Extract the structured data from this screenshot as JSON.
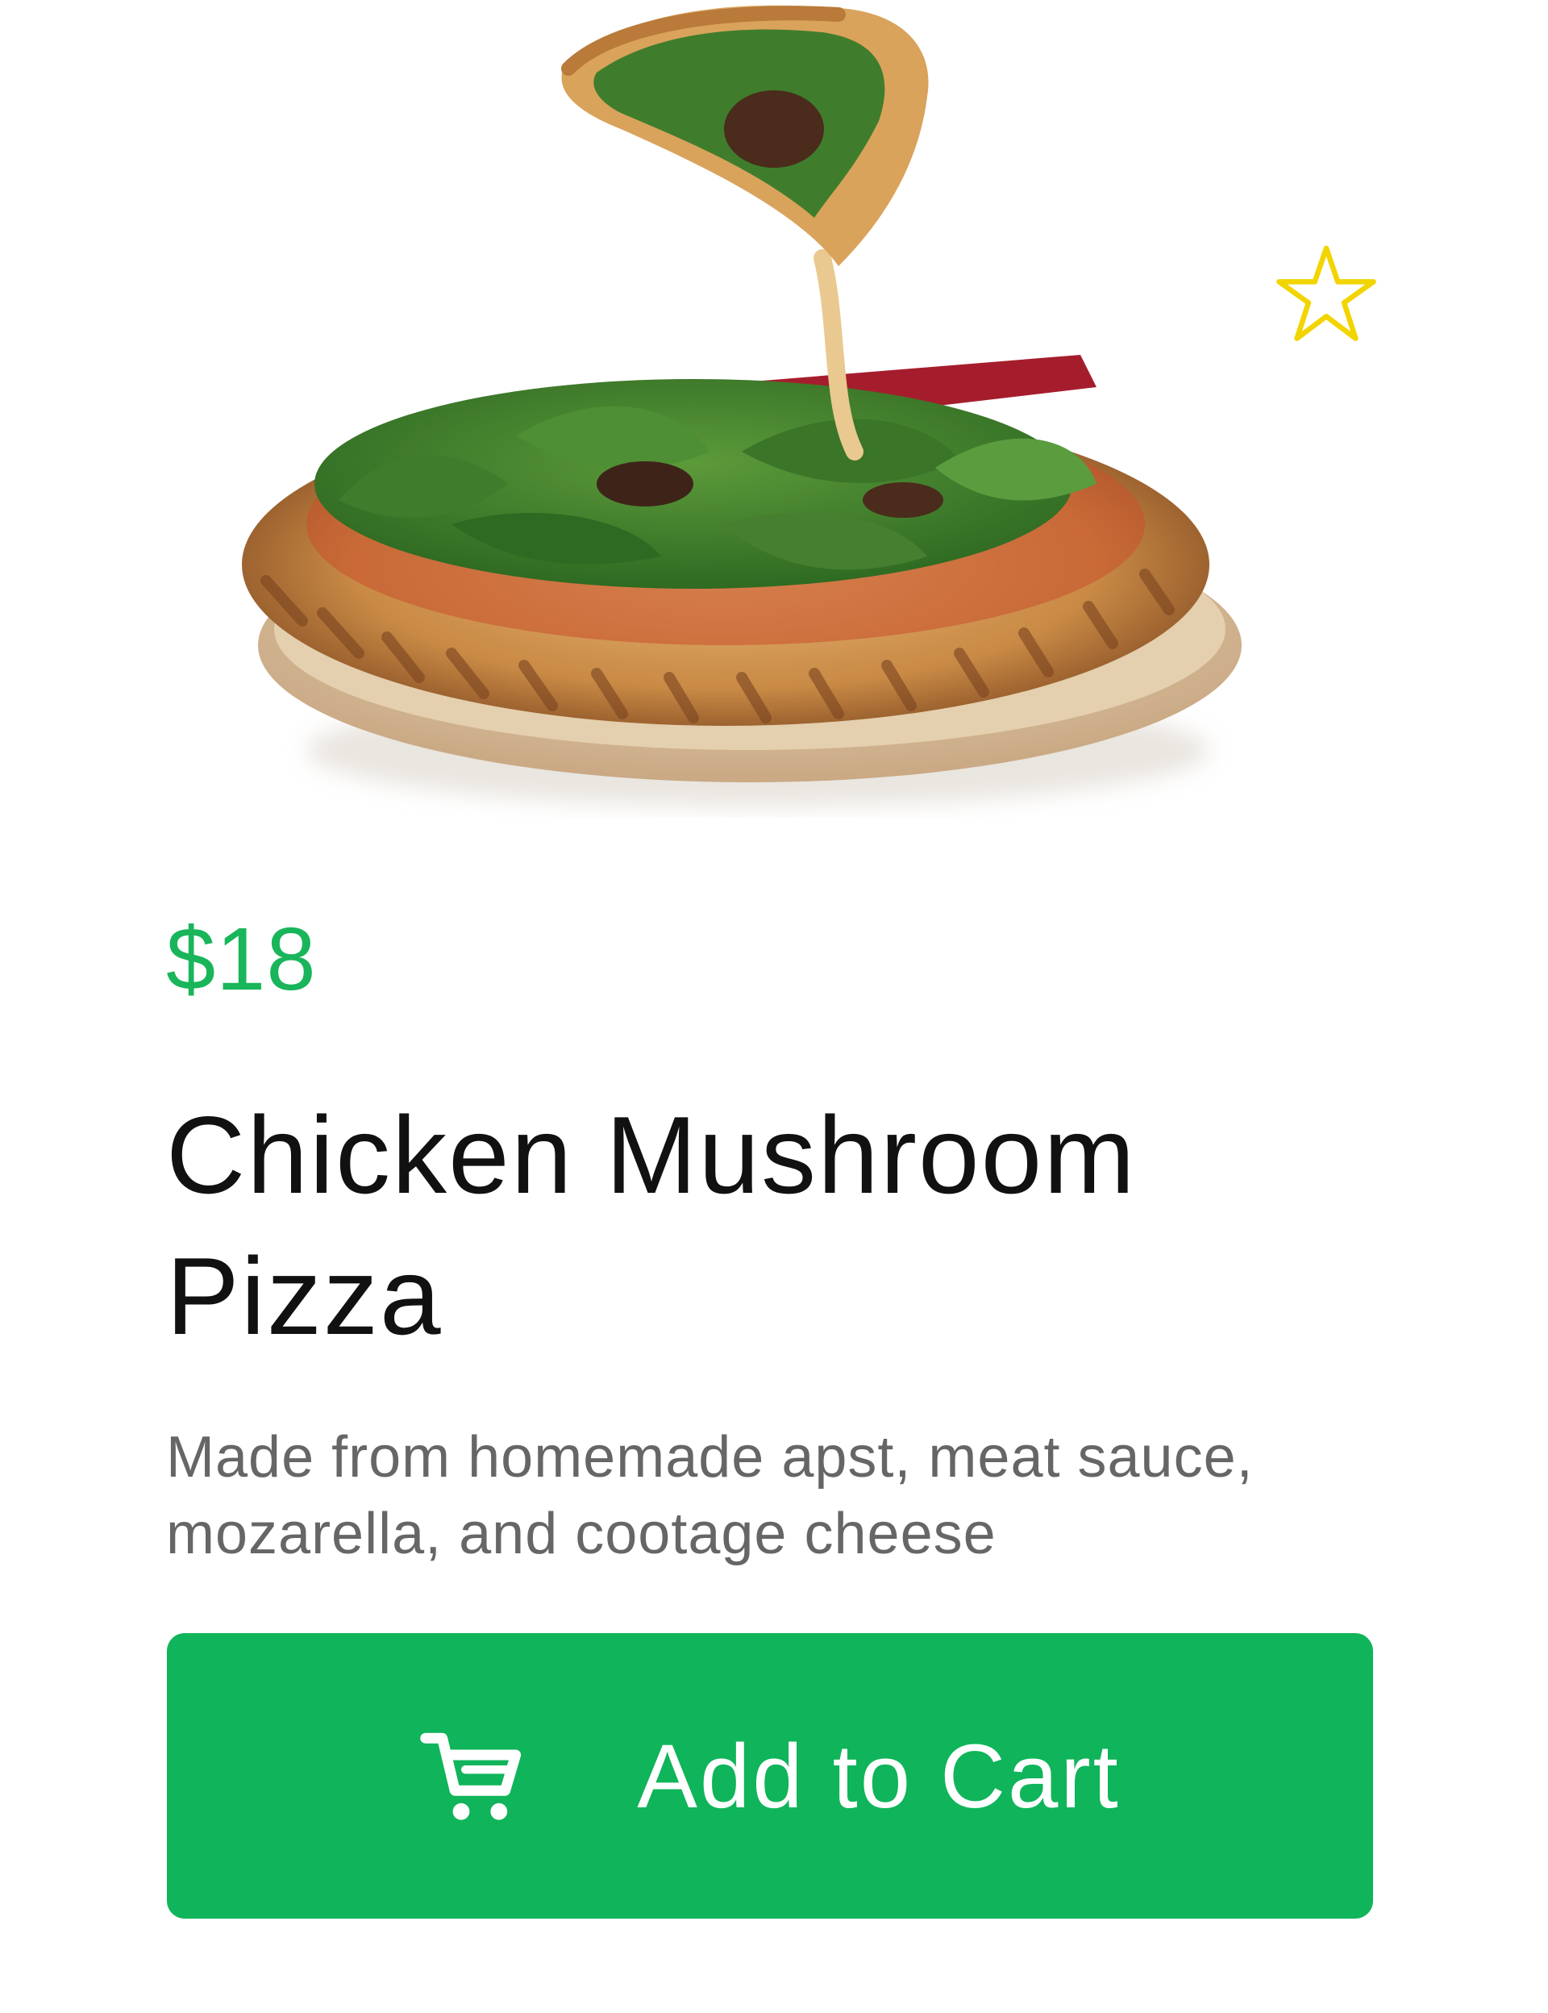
{
  "product": {
    "price": "$18",
    "title": "Chicken Mushroom Pizza",
    "description": "Made from homemade apst, meat sauce, mozarella, and cootage cheese",
    "image": "pizza-photo",
    "favorite_icon": "star-outline-icon",
    "favorite_color": "#f2d400"
  },
  "actions": {
    "add_to_cart_label": "Add to Cart",
    "add_to_cart_icon": "cart-icon",
    "button_color": "#10b45a"
  },
  "colors": {
    "price": "#19b55a",
    "title": "#111111",
    "description": "#666666"
  }
}
